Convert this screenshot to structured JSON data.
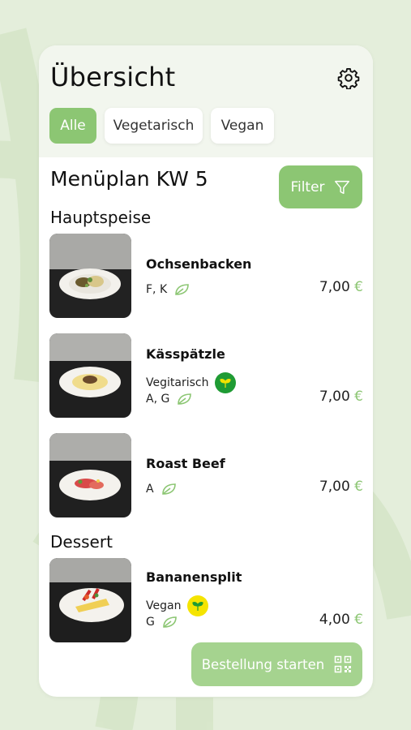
{
  "header": {
    "title": "Übersicht",
    "settings_icon": "gear-icon"
  },
  "filter_chips": [
    {
      "label": "Alle",
      "active": true
    },
    {
      "label": "Vegetarisch",
      "active": false
    },
    {
      "label": "Vegan",
      "active": false
    }
  ],
  "menu": {
    "title": "Menüplan KW 5",
    "filter_label": "Filter",
    "filter_icon": "funnel-icon"
  },
  "sections": [
    {
      "name": "Hauptspeise",
      "dishes": [
        {
          "name": "Ochsenbacken",
          "diet": "",
          "allergens": "F, K",
          "price": "7,00",
          "currency": "€"
        },
        {
          "name": "Kässpätzle",
          "diet": "Vegitarisch",
          "diet_badge_color": "#1f9b34",
          "allergens": "A, G",
          "price": "7,00",
          "currency": "€"
        },
        {
          "name": "Roast Beef",
          "diet": "",
          "allergens": "A",
          "price": "7,00",
          "currency": "€"
        }
      ]
    },
    {
      "name": "Dessert",
      "dishes": [
        {
          "name": "Bananensplit",
          "diet": "Vegan",
          "diet_badge_color": "#f5e400",
          "allergens": "G",
          "price": "4,00",
          "currency": "€"
        }
      ]
    }
  ],
  "order_button": {
    "label": "Bestellung starten",
    "icon": "qr-code-icon"
  },
  "colors": {
    "accent": "#8cc673",
    "background": "#e4eedb"
  }
}
